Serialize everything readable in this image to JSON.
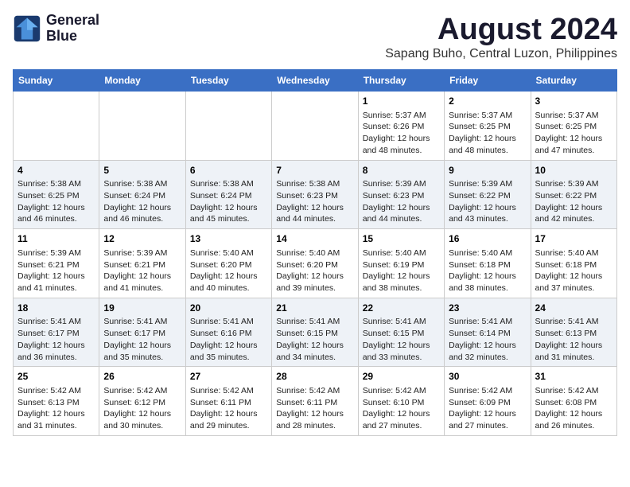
{
  "header": {
    "logo_line1": "General",
    "logo_line2": "Blue",
    "title": "August 2024",
    "subtitle": "Sapang Buho, Central Luzon, Philippines"
  },
  "days_of_week": [
    "Sunday",
    "Monday",
    "Tuesday",
    "Wednesday",
    "Thursday",
    "Friday",
    "Saturday"
  ],
  "weeks": [
    {
      "days": [
        {
          "num": "",
          "info": ""
        },
        {
          "num": "",
          "info": ""
        },
        {
          "num": "",
          "info": ""
        },
        {
          "num": "",
          "info": ""
        },
        {
          "num": "1",
          "info": "Sunrise: 5:37 AM\nSunset: 6:26 PM\nDaylight: 12 hours\nand 48 minutes."
        },
        {
          "num": "2",
          "info": "Sunrise: 5:37 AM\nSunset: 6:25 PM\nDaylight: 12 hours\nand 48 minutes."
        },
        {
          "num": "3",
          "info": "Sunrise: 5:37 AM\nSunset: 6:25 PM\nDaylight: 12 hours\nand 47 minutes."
        }
      ]
    },
    {
      "days": [
        {
          "num": "4",
          "info": "Sunrise: 5:38 AM\nSunset: 6:25 PM\nDaylight: 12 hours\nand 46 minutes."
        },
        {
          "num": "5",
          "info": "Sunrise: 5:38 AM\nSunset: 6:24 PM\nDaylight: 12 hours\nand 46 minutes."
        },
        {
          "num": "6",
          "info": "Sunrise: 5:38 AM\nSunset: 6:24 PM\nDaylight: 12 hours\nand 45 minutes."
        },
        {
          "num": "7",
          "info": "Sunrise: 5:38 AM\nSunset: 6:23 PM\nDaylight: 12 hours\nand 44 minutes."
        },
        {
          "num": "8",
          "info": "Sunrise: 5:39 AM\nSunset: 6:23 PM\nDaylight: 12 hours\nand 44 minutes."
        },
        {
          "num": "9",
          "info": "Sunrise: 5:39 AM\nSunset: 6:22 PM\nDaylight: 12 hours\nand 43 minutes."
        },
        {
          "num": "10",
          "info": "Sunrise: 5:39 AM\nSunset: 6:22 PM\nDaylight: 12 hours\nand 42 minutes."
        }
      ]
    },
    {
      "days": [
        {
          "num": "11",
          "info": "Sunrise: 5:39 AM\nSunset: 6:21 PM\nDaylight: 12 hours\nand 41 minutes."
        },
        {
          "num": "12",
          "info": "Sunrise: 5:39 AM\nSunset: 6:21 PM\nDaylight: 12 hours\nand 41 minutes."
        },
        {
          "num": "13",
          "info": "Sunrise: 5:40 AM\nSunset: 6:20 PM\nDaylight: 12 hours\nand 40 minutes."
        },
        {
          "num": "14",
          "info": "Sunrise: 5:40 AM\nSunset: 6:20 PM\nDaylight: 12 hours\nand 39 minutes."
        },
        {
          "num": "15",
          "info": "Sunrise: 5:40 AM\nSunset: 6:19 PM\nDaylight: 12 hours\nand 38 minutes."
        },
        {
          "num": "16",
          "info": "Sunrise: 5:40 AM\nSunset: 6:18 PM\nDaylight: 12 hours\nand 38 minutes."
        },
        {
          "num": "17",
          "info": "Sunrise: 5:40 AM\nSunset: 6:18 PM\nDaylight: 12 hours\nand 37 minutes."
        }
      ]
    },
    {
      "days": [
        {
          "num": "18",
          "info": "Sunrise: 5:41 AM\nSunset: 6:17 PM\nDaylight: 12 hours\nand 36 minutes."
        },
        {
          "num": "19",
          "info": "Sunrise: 5:41 AM\nSunset: 6:17 PM\nDaylight: 12 hours\nand 35 minutes."
        },
        {
          "num": "20",
          "info": "Sunrise: 5:41 AM\nSunset: 6:16 PM\nDaylight: 12 hours\nand 35 minutes."
        },
        {
          "num": "21",
          "info": "Sunrise: 5:41 AM\nSunset: 6:15 PM\nDaylight: 12 hours\nand 34 minutes."
        },
        {
          "num": "22",
          "info": "Sunrise: 5:41 AM\nSunset: 6:15 PM\nDaylight: 12 hours\nand 33 minutes."
        },
        {
          "num": "23",
          "info": "Sunrise: 5:41 AM\nSunset: 6:14 PM\nDaylight: 12 hours\nand 32 minutes."
        },
        {
          "num": "24",
          "info": "Sunrise: 5:41 AM\nSunset: 6:13 PM\nDaylight: 12 hours\nand 31 minutes."
        }
      ]
    },
    {
      "days": [
        {
          "num": "25",
          "info": "Sunrise: 5:42 AM\nSunset: 6:13 PM\nDaylight: 12 hours\nand 31 minutes."
        },
        {
          "num": "26",
          "info": "Sunrise: 5:42 AM\nSunset: 6:12 PM\nDaylight: 12 hours\nand 30 minutes."
        },
        {
          "num": "27",
          "info": "Sunrise: 5:42 AM\nSunset: 6:11 PM\nDaylight: 12 hours\nand 29 minutes."
        },
        {
          "num": "28",
          "info": "Sunrise: 5:42 AM\nSunset: 6:11 PM\nDaylight: 12 hours\nand 28 minutes."
        },
        {
          "num": "29",
          "info": "Sunrise: 5:42 AM\nSunset: 6:10 PM\nDaylight: 12 hours\nand 27 minutes."
        },
        {
          "num": "30",
          "info": "Sunrise: 5:42 AM\nSunset: 6:09 PM\nDaylight: 12 hours\nand 27 minutes."
        },
        {
          "num": "31",
          "info": "Sunrise: 5:42 AM\nSunset: 6:08 PM\nDaylight: 12 hours\nand 26 minutes."
        }
      ]
    }
  ]
}
